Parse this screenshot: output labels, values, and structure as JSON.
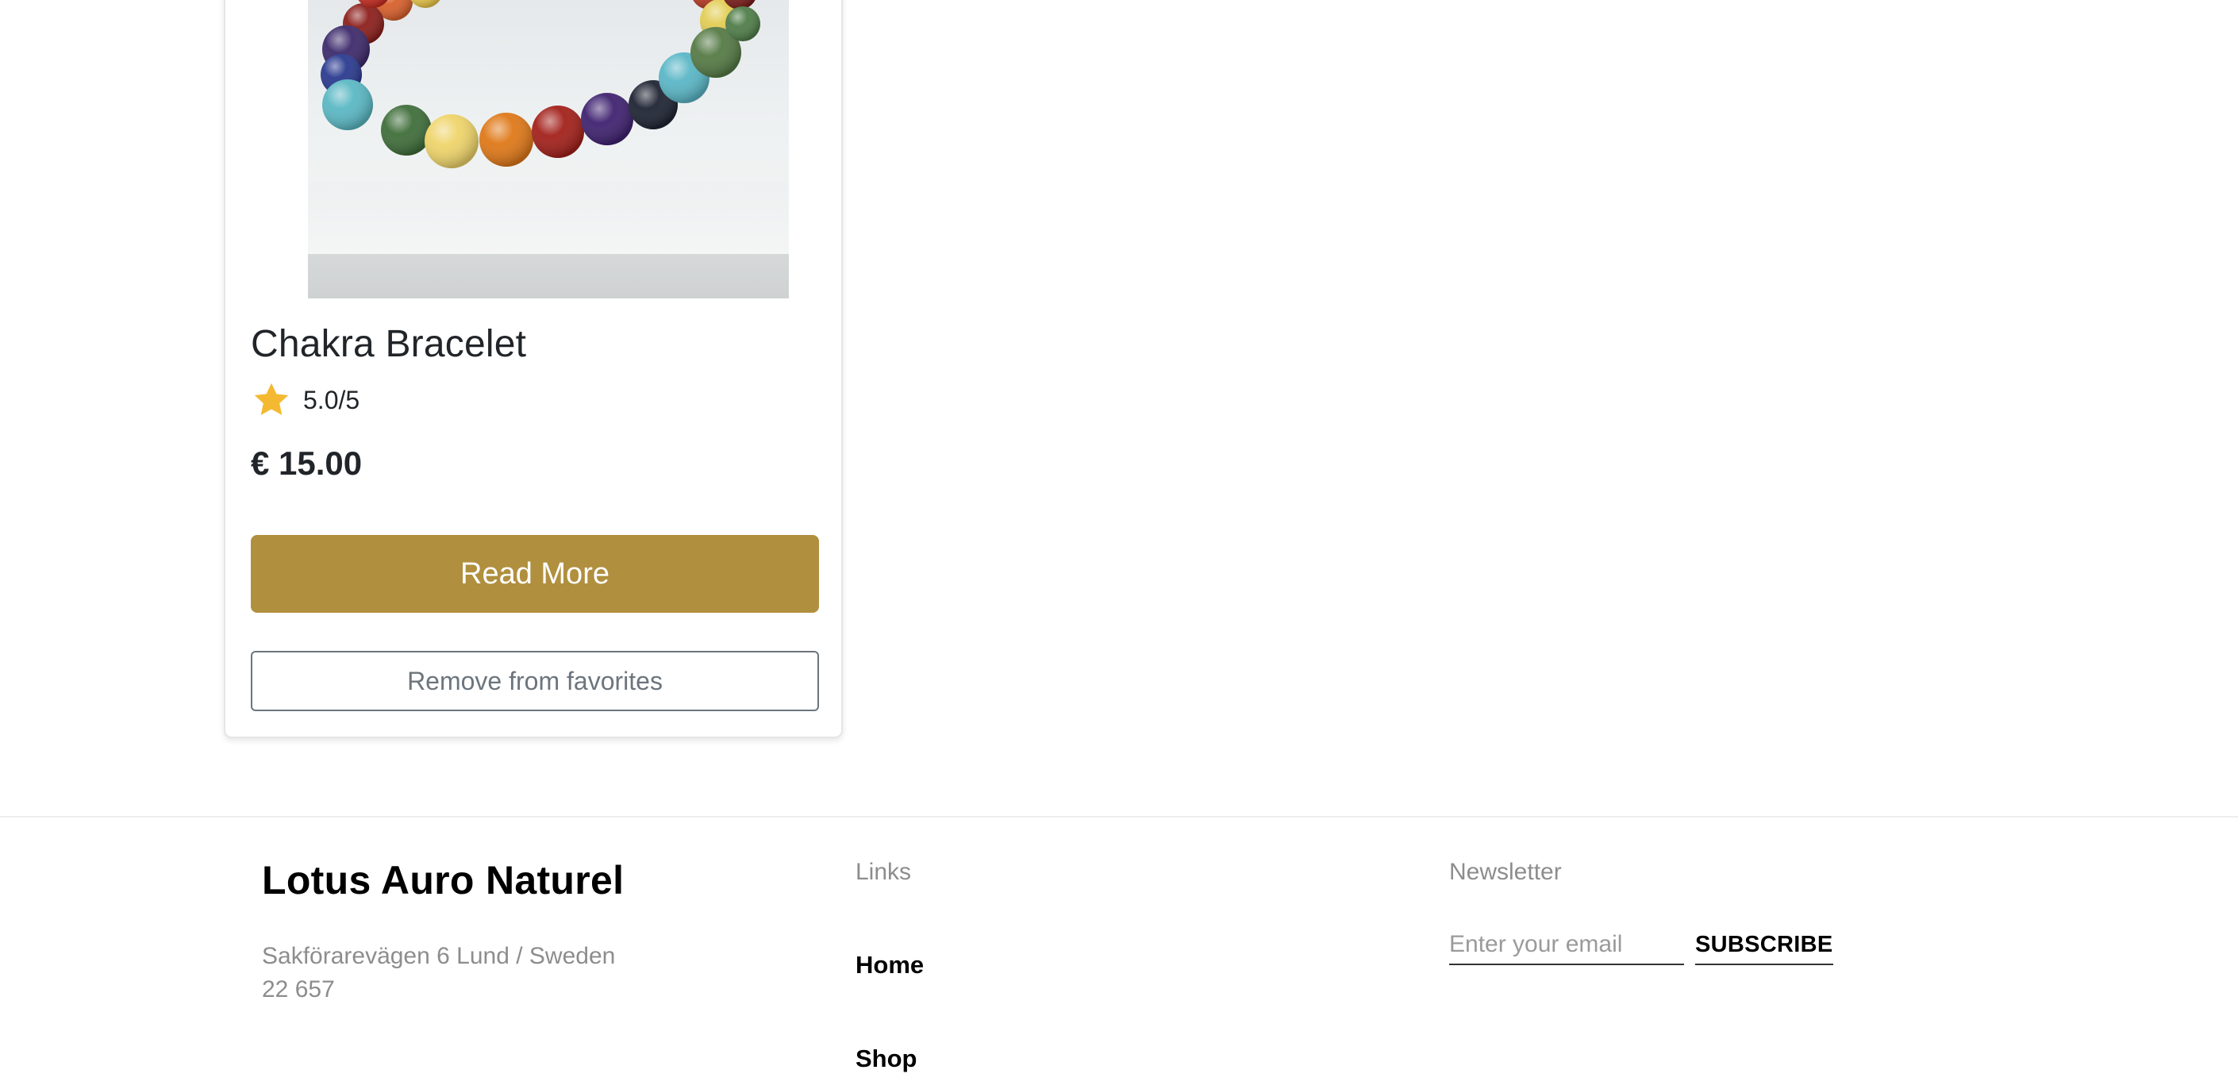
{
  "product": {
    "image_alt": "Chakra bracelet with multicolored gemstone beads",
    "title": "Chakra Bracelet",
    "rating_icon": "star-icon",
    "rating_text": "5.0/5",
    "price": "€ 15.00",
    "read_more_label": "Read More",
    "remove_label": "Remove from favorites"
  },
  "footer": {
    "brand": "Lotus Auro Naturel",
    "address_line1": "Sakförarevägen 6 Lund / Sweden",
    "address_line2": "22 657",
    "links_heading": "Links",
    "links": [
      "Home",
      "Shop"
    ],
    "newsletter_heading": "Newsletter",
    "email_placeholder": "Enter your email",
    "subscribe_label": "SUBSCRIBE"
  },
  "colors": {
    "accent": "#b08f3e",
    "star": "#f4b931",
    "text": "#212529",
    "muted": "#8d8d8d",
    "outline": "#6c757d"
  }
}
